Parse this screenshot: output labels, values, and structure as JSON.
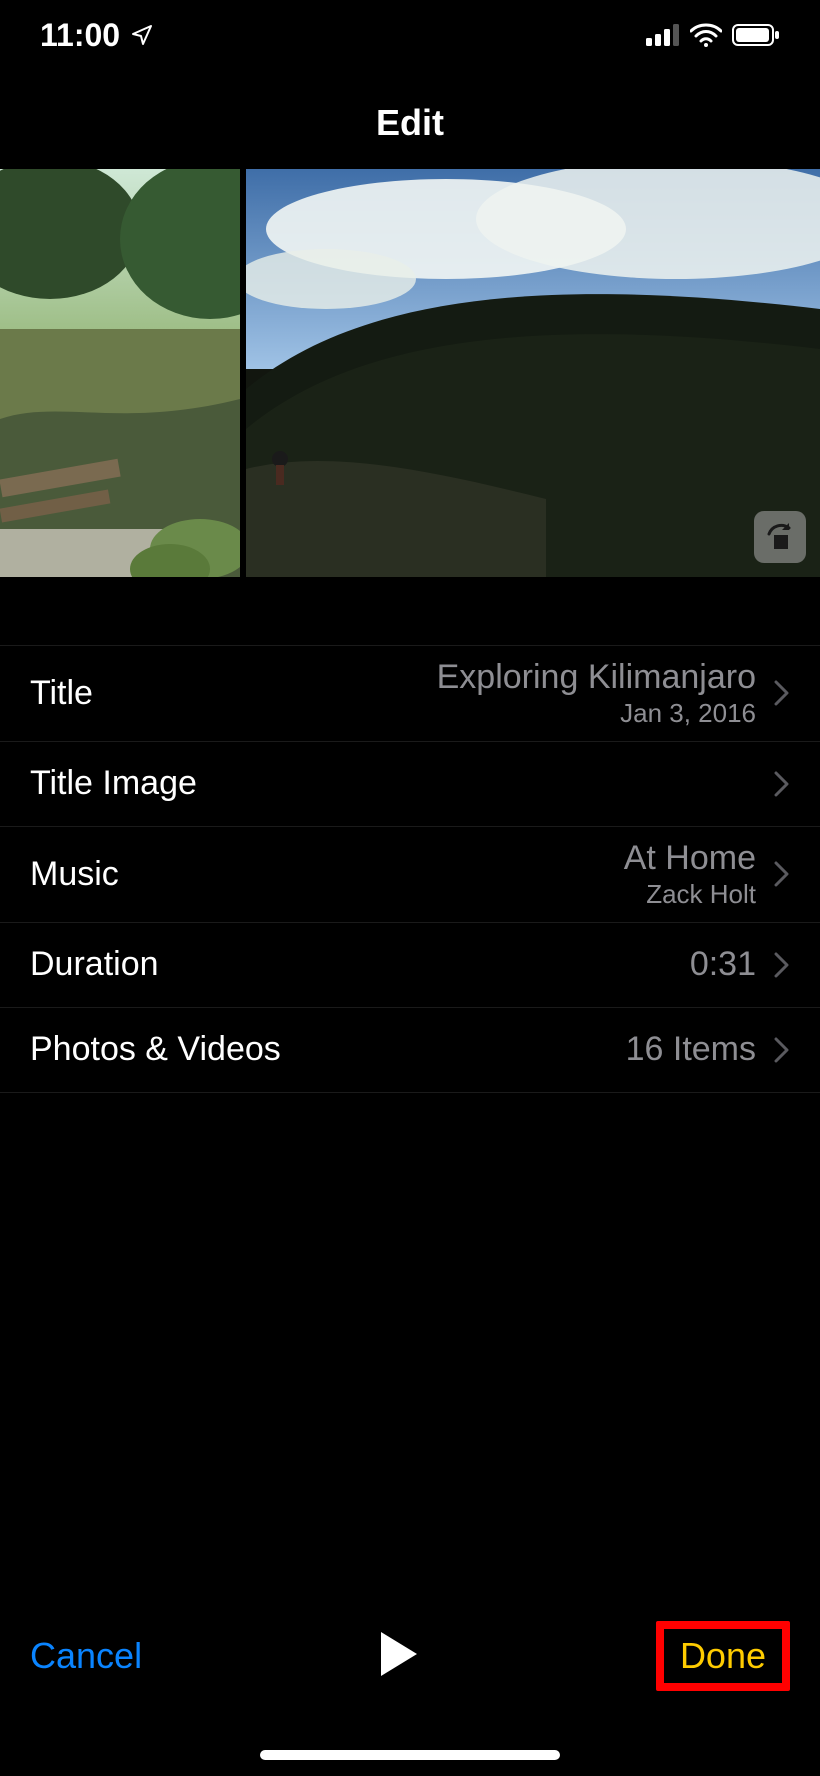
{
  "status": {
    "time": "11:00"
  },
  "header": {
    "title": "Edit"
  },
  "rows": {
    "title": {
      "label": "Title",
      "value": "Exploring Kilimanjaro",
      "sub": "Jan 3, 2016"
    },
    "image": {
      "label": "Title Image",
      "value": "",
      "sub": ""
    },
    "music": {
      "label": "Music",
      "value": "At Home",
      "sub": "Zack Holt"
    },
    "duration": {
      "label": "Duration",
      "value": "0:31",
      "sub": ""
    },
    "media": {
      "label": "Photos & Videos",
      "value": "16 Items",
      "sub": ""
    }
  },
  "toolbar": {
    "cancel": "Cancel",
    "done": "Done"
  }
}
